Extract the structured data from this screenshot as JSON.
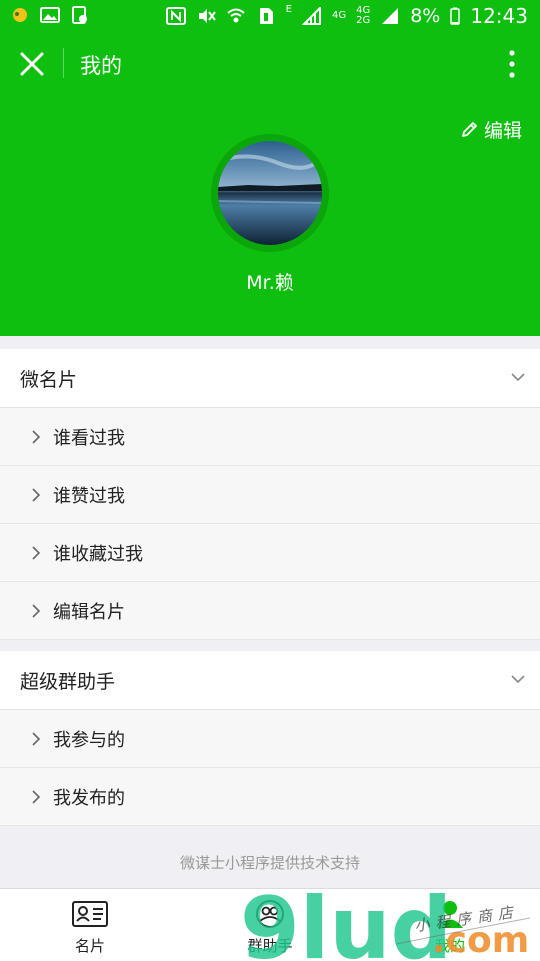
{
  "status_bar": {
    "battery": "8%",
    "time": "12:43",
    "net_a": "4G",
    "net_b": "4G",
    "net_c": "2G",
    "e_label": "E"
  },
  "header": {
    "title": "我的",
    "edit_label": "编辑"
  },
  "profile": {
    "name": "Mr.赖"
  },
  "sections": [
    {
      "title": "微名片",
      "items": [
        "谁看过我",
        "谁赞过我",
        "谁收藏过我",
        "编辑名片"
      ]
    },
    {
      "title": "超级群助手",
      "items": [
        "我参与的",
        "我发布的"
      ]
    }
  ],
  "footer": {
    "note": "微谋士小程序提供技术支持"
  },
  "tabbar": {
    "tabs": [
      {
        "label": "名片",
        "icon": "card-icon"
      },
      {
        "label": "群助手",
        "icon": "group-icon"
      },
      {
        "label": "我的",
        "icon": "person-icon"
      }
    ],
    "active_index": 2
  },
  "watermark": {
    "main": "9lud",
    "domain": ".com",
    "script": "小程序商店"
  },
  "colors": {
    "brand_green": "#0fbf0f",
    "background": "#efeff4"
  }
}
